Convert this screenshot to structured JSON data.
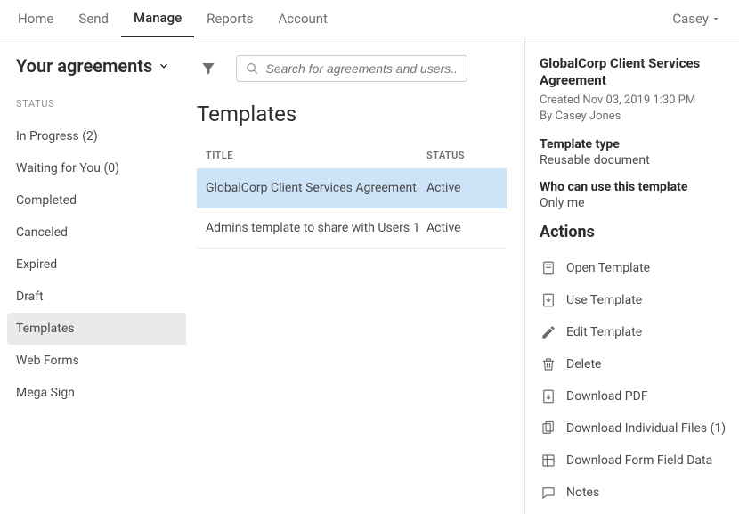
{
  "topnav": {
    "items": [
      "Home",
      "Send",
      "Manage",
      "Reports",
      "Account"
    ],
    "active_index": 2,
    "user": "Casey"
  },
  "sidebar": {
    "title": "Your agreements",
    "section_label": "STATUS",
    "items": [
      "In Progress (2)",
      "Waiting for You (0)",
      "Completed",
      "Canceled",
      "Expired",
      "Draft",
      "Templates",
      "Web Forms",
      "Mega Sign"
    ],
    "selected_index": 6
  },
  "search": {
    "placeholder": "Search for agreements and users..."
  },
  "content": {
    "heading": "Templates",
    "columns": {
      "title": "TITLE",
      "status": "STATUS"
    },
    "rows": [
      {
        "title": "GlobalCorp Client Services Agreement",
        "status": "Active"
      },
      {
        "title": "Admins template to share with Users 1",
        "status": "Active"
      }
    ],
    "selected_index": 0
  },
  "details": {
    "title": "GlobalCorp Client Services Agreement",
    "created": "Created Nov 03, 2019 1:30 PM",
    "by": "By Casey Jones",
    "template_type_label": "Template type",
    "template_type_value": "Reusable document",
    "who_label": "Who can use this template",
    "who_value": "Only me",
    "actions_label": "Actions",
    "actions": [
      {
        "icon": "open",
        "label": "Open Template"
      },
      {
        "icon": "use",
        "label": "Use Template"
      },
      {
        "icon": "edit",
        "label": "Edit Template"
      },
      {
        "icon": "delete",
        "label": "Delete"
      },
      {
        "icon": "pdf",
        "label": "Download PDF"
      },
      {
        "icon": "files",
        "label": "Download Individual Files (1)"
      },
      {
        "icon": "formdata",
        "label": "Download Form Field Data"
      },
      {
        "icon": "notes",
        "label": "Notes"
      }
    ]
  }
}
